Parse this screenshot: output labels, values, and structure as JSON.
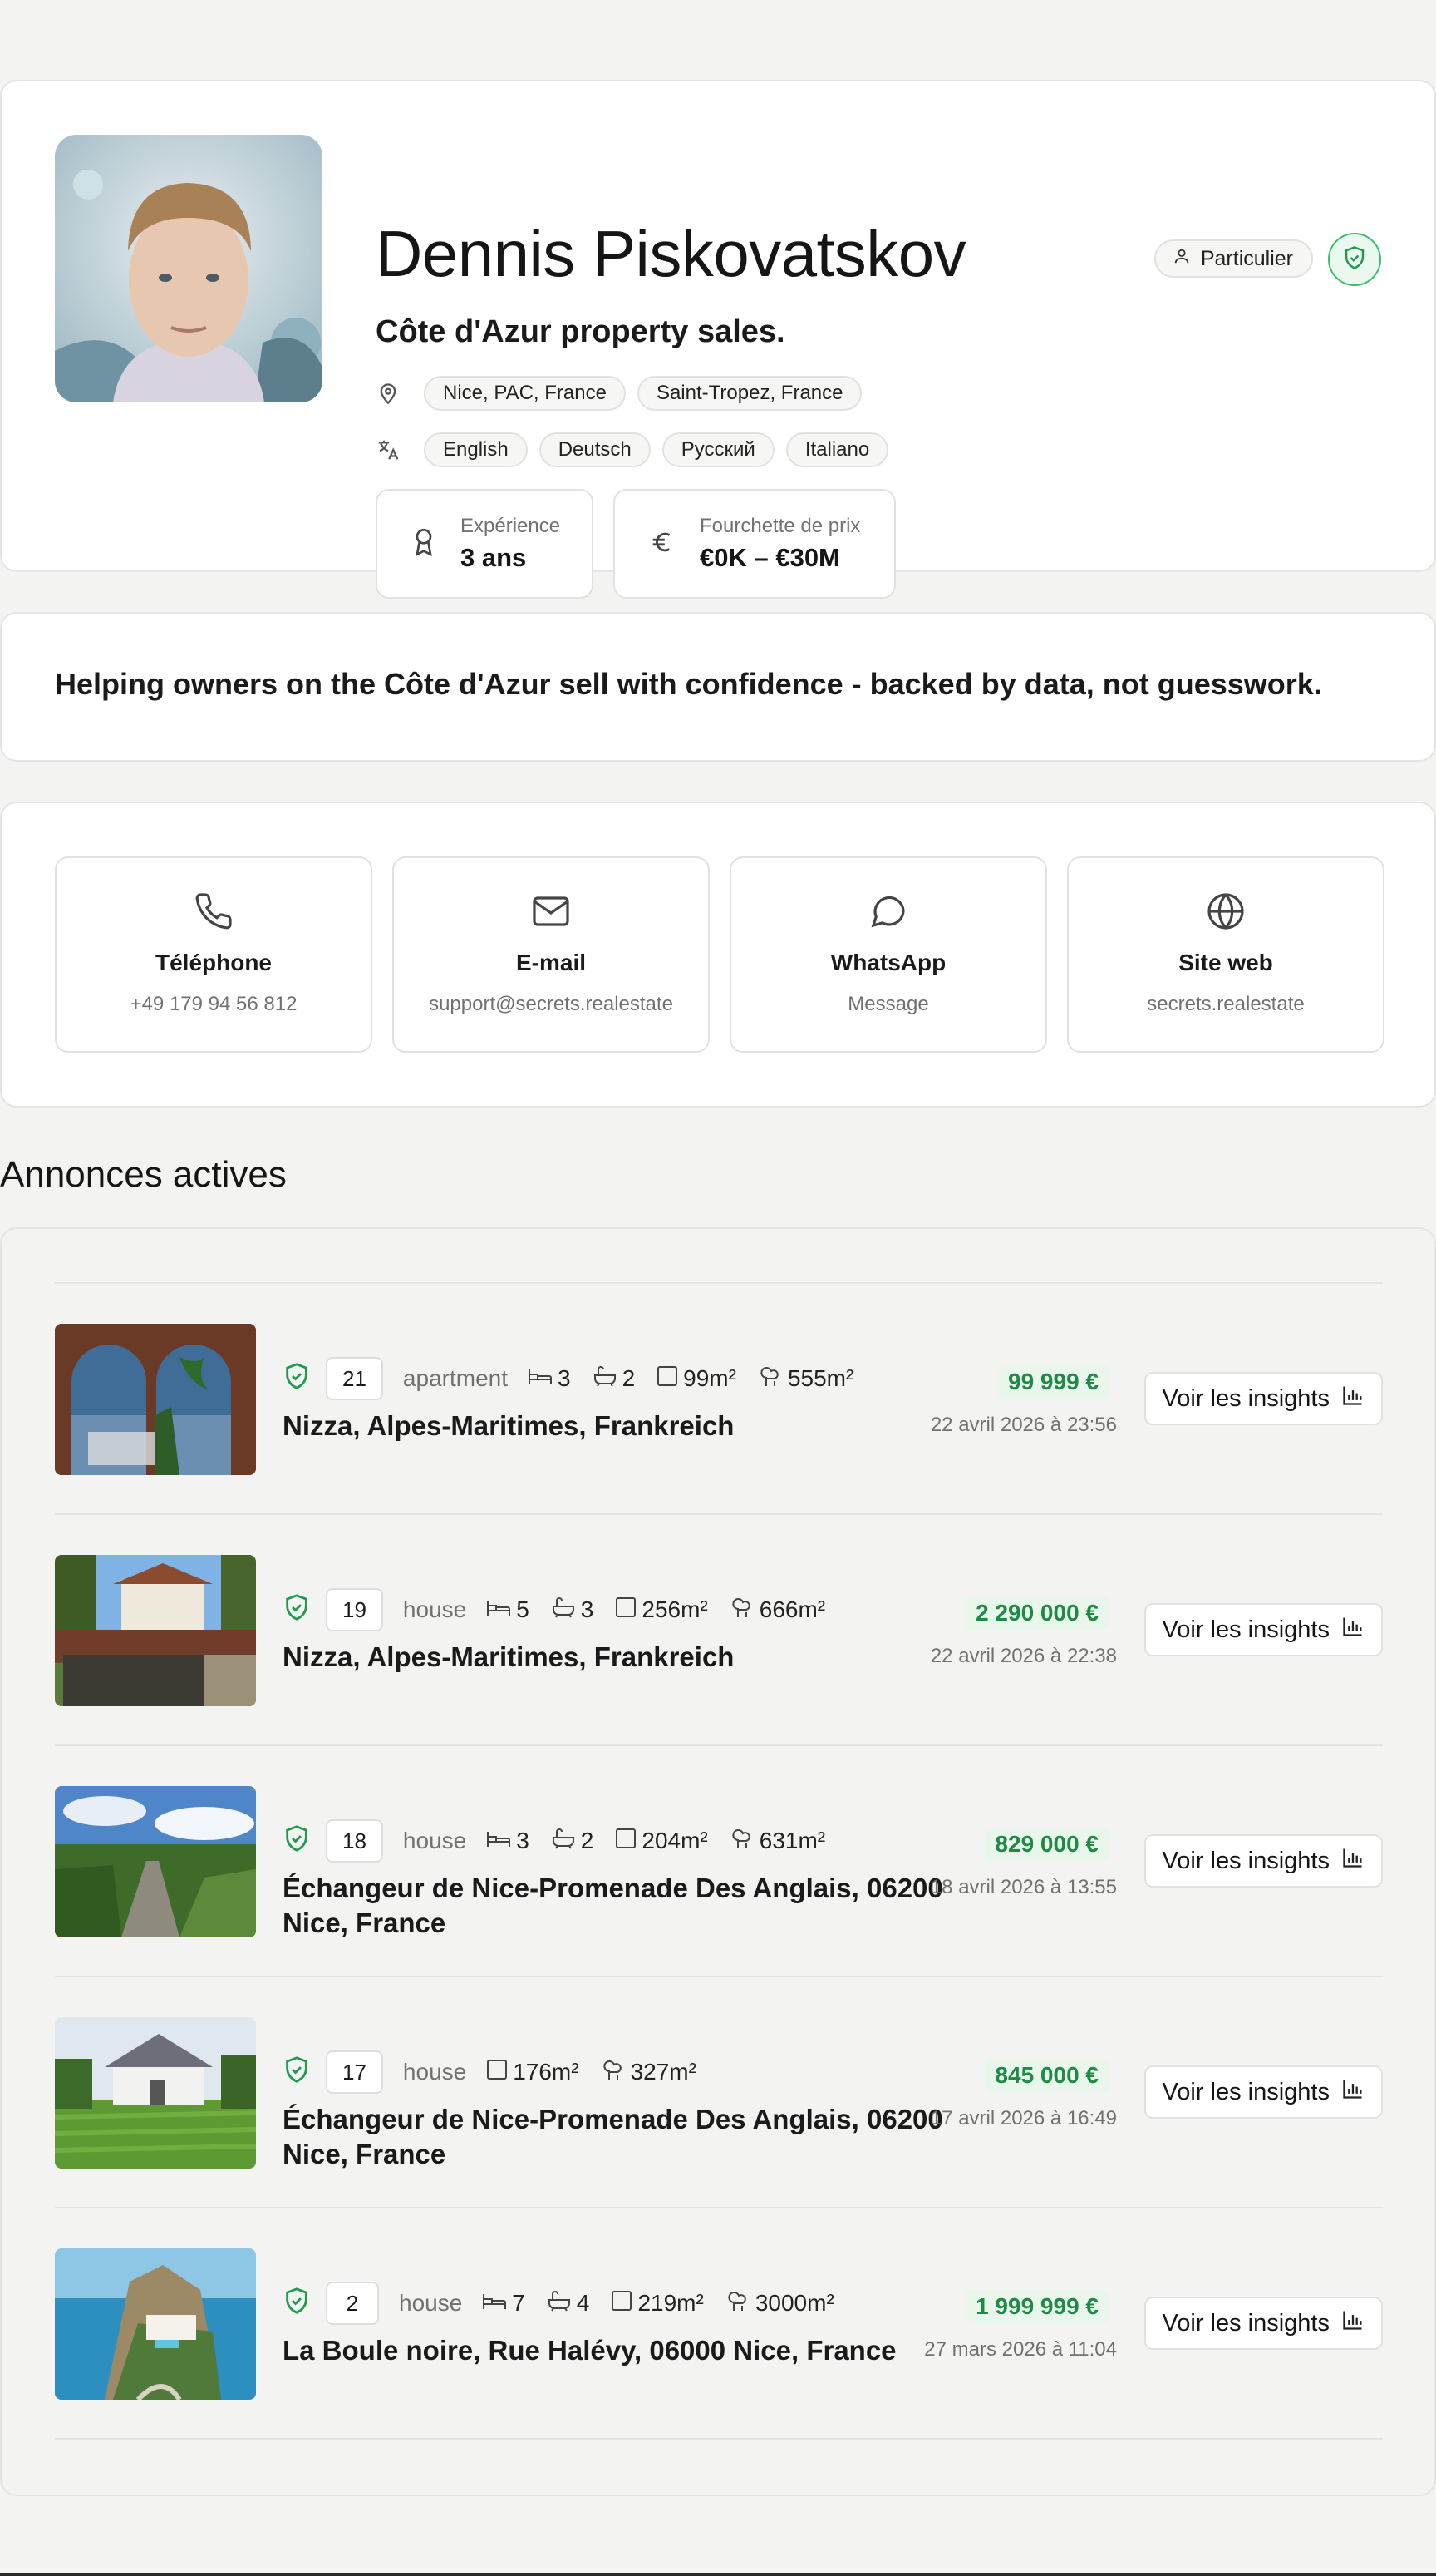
{
  "profile": {
    "name": "Dennis Piskovatskov",
    "tagline": "Côte d'Azur property sales.",
    "role_badge": "Particulier",
    "locations": [
      "Nice, PAC, France",
      "Saint-Tropez, France"
    ],
    "languages": [
      "English",
      "Deutsch",
      "Русский",
      "Italiano"
    ],
    "experience": {
      "label": "Expérience",
      "value": "3 ans"
    },
    "price_range": {
      "label": "Fourchette de prix",
      "value": "€0K – €30M"
    }
  },
  "about": {
    "text": "Helping owners on the Côte d'Azur sell with confidence - backed by data, not guesswork."
  },
  "contact": [
    {
      "title": "Téléphone",
      "sub": "+49 179 94 56 812",
      "icon": "phone-icon"
    },
    {
      "title": "E-mail",
      "sub": "support@secrets.realestate",
      "icon": "mail-icon"
    },
    {
      "title": "WhatsApp",
      "sub": "Message",
      "icon": "chat-icon"
    },
    {
      "title": "Site web",
      "sub": "secrets.realestate",
      "icon": "globe-icon"
    }
  ],
  "listings_title": "Annonces actives",
  "insights_label": "Voir les insights",
  "colors": {
    "accent_green": "#1f8a45",
    "verify_green": "#3bbf6a",
    "page_bg": "#f3f4f2"
  },
  "listings": [
    {
      "num": "21",
      "type": "apartment",
      "beds": "3",
      "baths": "2",
      "area": "99m²",
      "land": "555m²",
      "address": "Nizza, Alpes-Maritimes, Frankreich",
      "price": "99 999 €",
      "date": "22 avril 2026 à 23:56"
    },
    {
      "num": "19",
      "type": "house",
      "beds": "5",
      "baths": "3",
      "area": "256m²",
      "land": "666m²",
      "address": "Nizza, Alpes-Maritimes, Frankreich",
      "price": "2 290 000 €",
      "date": "22 avril 2026 à 22:38"
    },
    {
      "num": "18",
      "type": "house",
      "beds": "3",
      "baths": "2",
      "area": "204m²",
      "land": "631m²",
      "address": "Échangeur de Nice-Promenade Des Anglais, 06200 Nice, France",
      "price": "829 000 €",
      "date": "18 avril 2026 à 13:55"
    },
    {
      "num": "17",
      "type": "house",
      "area": "176m²",
      "land": "327m²",
      "address": "Échangeur de Nice-Promenade Des Anglais, 06200 Nice, France",
      "price": "845 000 €",
      "date": "17 avril 2026 à 16:49"
    },
    {
      "num": "2",
      "type": "house",
      "beds": "7",
      "baths": "4",
      "area": "219m²",
      "land": "3000m²",
      "address": "La Boule noire, Rue Halévy, 06000 Nice, France",
      "price": "1 999 999 €",
      "date": "27 mars 2026 à 11:04"
    }
  ]
}
